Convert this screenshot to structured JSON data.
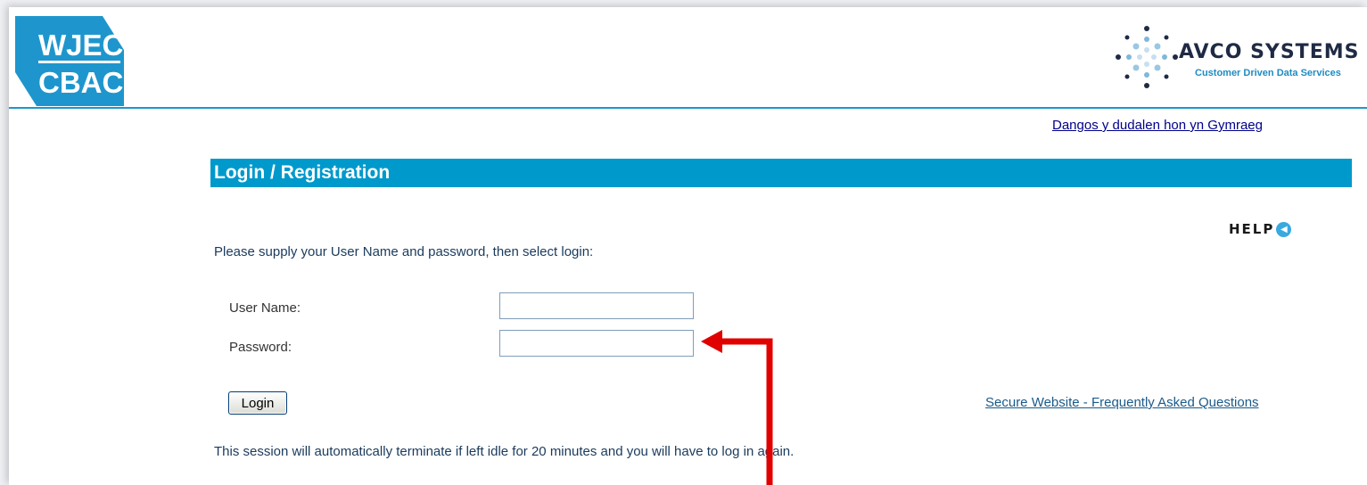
{
  "header": {
    "left_logo": {
      "line1": "WJEC",
      "line2": "CBAC",
      "color": "#1e96cd"
    },
    "right_logo": {
      "name": "AVCO SYSTEMS",
      "tagline": "Customer Driven Data Services"
    },
    "language_link": "Dangos y dudalen hon yn Gymraeg"
  },
  "section": {
    "title": "Login / Registration",
    "bar_color": "#0099cc",
    "help_label": "HELP",
    "help_icon": "help-circle-arrow-icon"
  },
  "form": {
    "intro": "Please supply your User Name and password, then select login:",
    "username_label": "User Name:",
    "username_value": "",
    "password_label": "Password:",
    "password_value": "",
    "login_button": "Login"
  },
  "links": {
    "faq": "Secure Website - Frequently Asked Questions"
  },
  "notice": "This session will automatically terminate if left idle for 20 minutes and you will have to log in again.",
  "annotation": {
    "shape": "red-elbow-arrow",
    "color": "#e00000"
  }
}
